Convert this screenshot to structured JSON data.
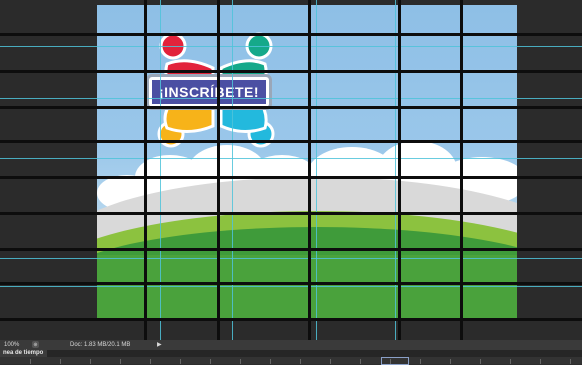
{
  "canvas": {
    "badge_text": "¡INSCRÍBETE!"
  },
  "statusbar": {
    "zoom": "100%",
    "doc_info": "Doc: 1.83 MB/20.1 MB",
    "arrow": "▶"
  },
  "timeline": {
    "tab_label": "nea de tiempo"
  },
  "colors": {
    "sky": "#9ac7ea",
    "grass_dark": "#3f9b3a",
    "grass_light": "#8cc23f",
    "badge": "#4b4fa3",
    "guide": "#4fc3d9"
  },
  "icons": {
    "figure_red": "red",
    "figure_green": "teal-green",
    "figure_yellow": "yellow",
    "figure_cyan": "cyan"
  }
}
